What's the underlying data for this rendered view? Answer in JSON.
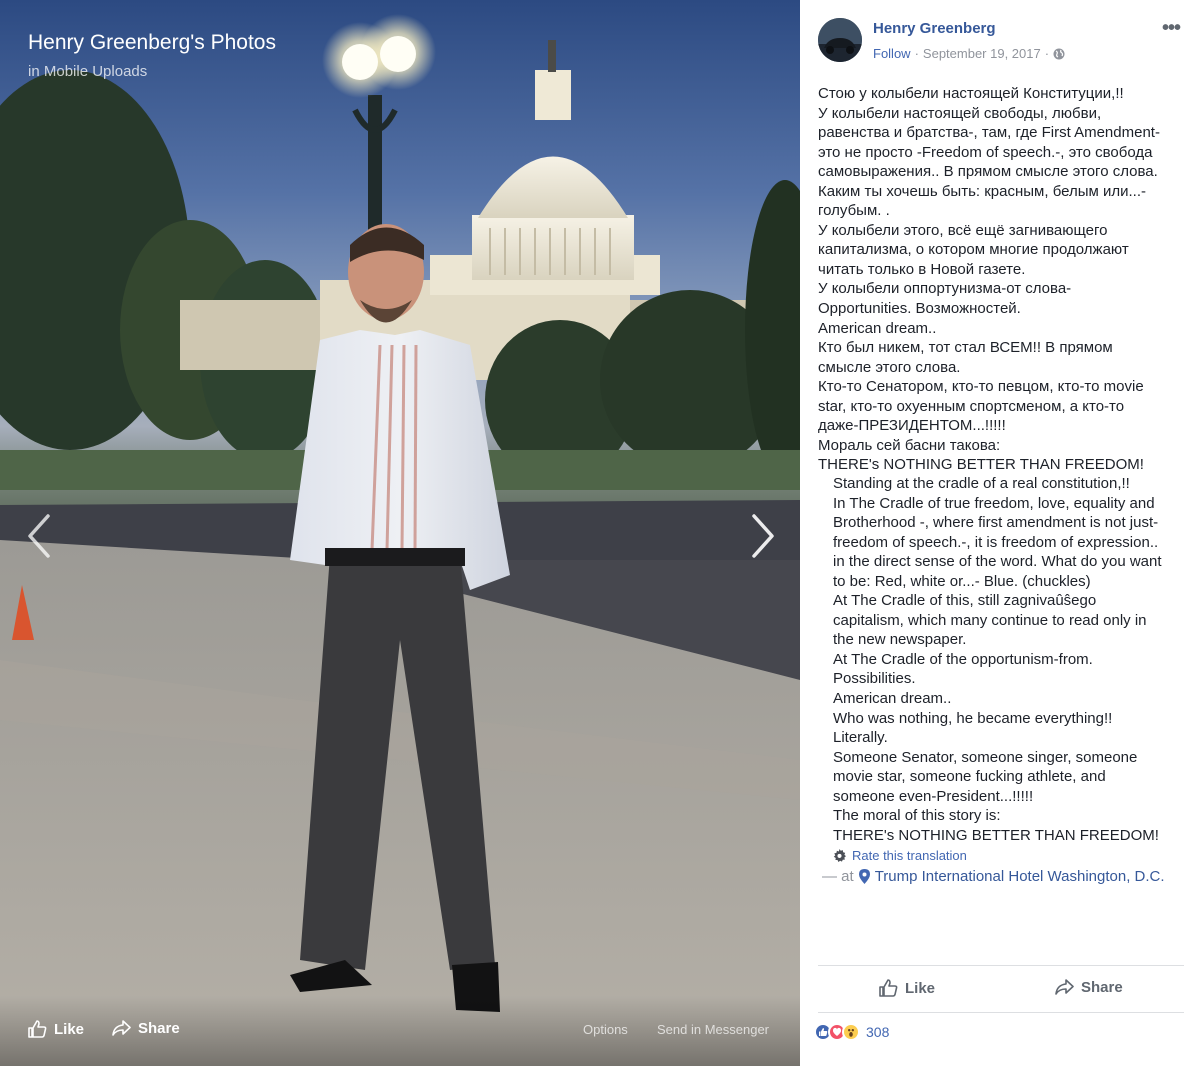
{
  "viewer": {
    "title": "Henry Greenberg's Photos",
    "subtitle_prefix": "in",
    "album": "Mobile Uploads",
    "actions": {
      "like": "Like",
      "share": "Share",
      "options": "Options",
      "send_messenger": "Send in Messenger"
    },
    "icons": [
      "chevron-left-icon",
      "chevron-right-icon",
      "thumbs-up-icon",
      "share-arrow-icon"
    ]
  },
  "post": {
    "author": "Henry Greenberg",
    "follow": "Follow",
    "date": "September 19, 2017",
    "separator": "·",
    "more": "•••",
    "original_lines": [
      "Стою у колыбели настоящей Конституции,!!",
      "У колыбели настоящей свободы, любви,",
      "равенства и братства-, там, где First Amendment-",
      "это не просто -Freedom of speech.-, это свобода",
      "самовыражения.. В прямом смысле этого слова.",
      "Каким ты хочешь быть: красным, белым или...-",
      "голубым. .",
      "У колыбели этого, всё ещё загнивающего",
      "капитализма, о котором многие продолжают",
      "читать только в Новой газете.",
      "У колыбели оппортунизма-от слова-",
      "Opportunities. Возможностей.",
      "American dream..",
      "Кто был никем, тот стал ВСЕМ!! В прямом",
      "смысле этого слова.",
      "Кто-то Сенатором, кто-то певцом, кто-то movie",
      "star, кто-то охуенным спортсменом, а кто-то",
      "даже-ПРЕЗИДЕНТОМ...!!!!!",
      "Мораль сей басни такова:",
      "THERE's NOTHING BETTER THAN FREEDOM!"
    ],
    "translation_lines": [
      "Standing at the cradle of a real constitution,!!",
      "In The Cradle of true freedom, love, equality and",
      "Brotherhood -, where first amendment is not just-",
      "freedom of speech.-, it is freedom of expression..",
      "in the direct sense of the word. What do you want",
      "to be: Red, white or...- Blue. (chuckles)",
      "At The Cradle of this, still zagnivaûŝego",
      "capitalism, which many continue to read only in",
      "the new newspaper.",
      "At The Cradle of the opportunism-from.",
      "Possibilities.",
      "American dream..",
      "Who was nothing, he became everything!!",
      "Literally.",
      "Someone Senator, someone singer, someone",
      "movie star, someone fucking athlete, and",
      "someone even-President...!!!!!",
      "The moral of this story is:",
      "THERE's NOTHING BETTER THAN FREEDOM!"
    ],
    "rate_translation": "Rate this translation",
    "location_prefix": "— at",
    "location": "Trump International Hotel Washington, D.C.",
    "actions": {
      "like": "Like",
      "share": "Share"
    },
    "reaction_count": "308",
    "reactions": [
      "like",
      "love",
      "wow"
    ],
    "colors": {
      "link": "#365899",
      "like_blue": "#4267b2",
      "love_red": "#f25268",
      "wow_yellow": "#fccd50",
      "meta_gray": "#90949c"
    }
  }
}
